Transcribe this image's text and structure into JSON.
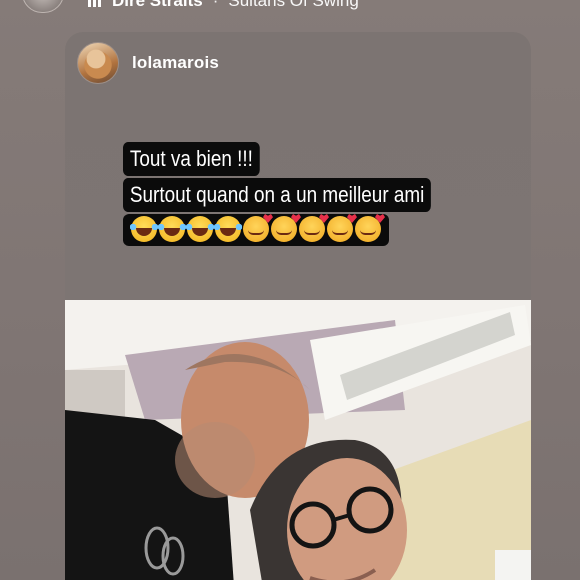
{
  "music": {
    "artist": "Dire Straits",
    "separator": "·",
    "song": "Sultans Of Swing",
    "icon": "music-bars-icon"
  },
  "story": {
    "username": "lolamarois",
    "caption_lines": [
      "Tout va bien !!!",
      "Surtout  quand on a un meilleur ami"
    ],
    "emojis": [
      "laugh-tears",
      "laugh-tears",
      "laugh-tears",
      "laugh-tears",
      "smiling-hearts",
      "smiling-hearts",
      "smiling-hearts",
      "smiling-hearts",
      "smiling-hearts"
    ],
    "photo": "selfie-two-men-hospital-room"
  },
  "colors": {
    "background": "#857b78",
    "card": "#7c7472",
    "caption_bg": "#0b0b0b",
    "text": "#ffffff"
  }
}
